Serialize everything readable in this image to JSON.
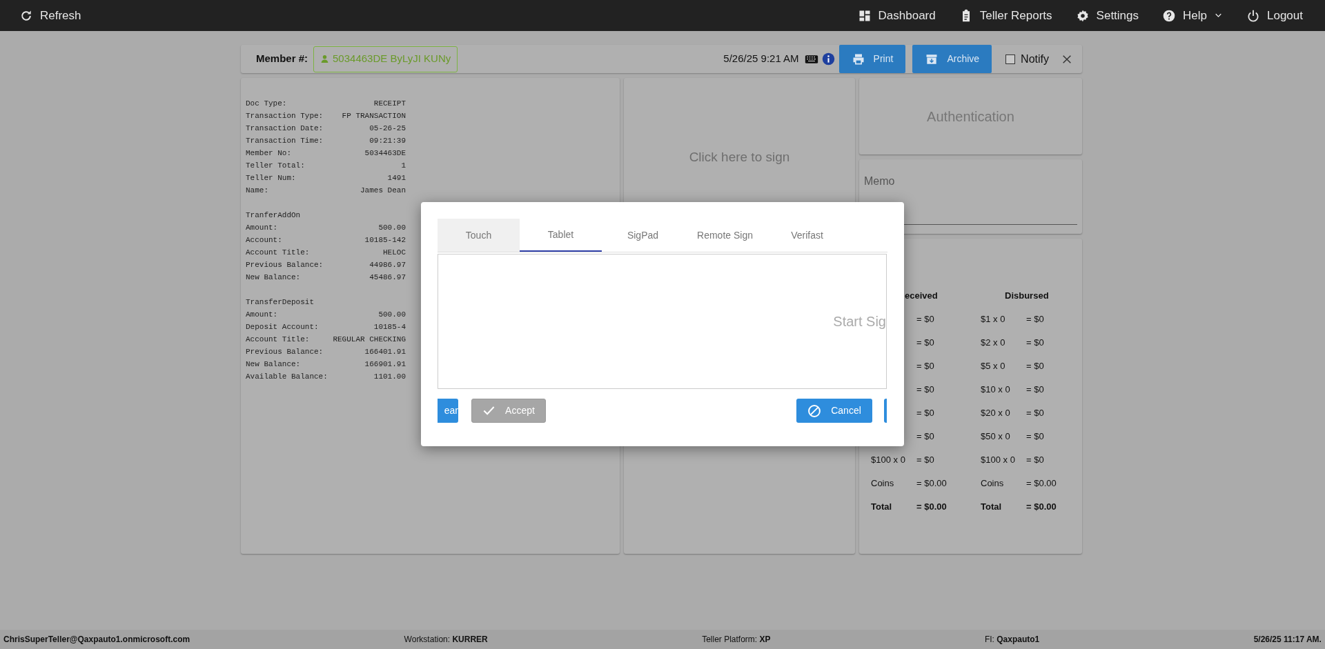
{
  "topbar": {
    "left": [
      {
        "kind": "refresh",
        "label": "Refresh"
      }
    ],
    "right": [
      {
        "kind": "dashboard",
        "label": "Dashboard",
        "dropdown": false
      },
      {
        "kind": "clipboard",
        "label": "Teller Reports",
        "dropdown": false
      },
      {
        "kind": "gear",
        "label": "Settings",
        "dropdown": false
      },
      {
        "kind": "help",
        "label": "Help",
        "dropdown": true
      },
      {
        "kind": "power",
        "label": "Logout",
        "dropdown": false
      }
    ]
  },
  "member_bar": {
    "label": "Member #:",
    "member": "5034463DE ByLyJI KUNy",
    "datetime": "5/26/25 9:21 AM",
    "buttons": [
      {
        "kind": "print",
        "label": "Print"
      },
      {
        "kind": "archive",
        "label": "Archive"
      }
    ],
    "notify": {
      "label": "Notify",
      "checked": false
    }
  },
  "receipt": {
    "groups": [
      {
        "lines": [
          [
            "Doc Type:",
            "RECEIPT"
          ],
          [
            "Transaction Type:",
            "FP TRANSACTION"
          ],
          [
            "Transaction Date:",
            "05-26-25"
          ],
          [
            "Transaction Time:",
            "09:21:39"
          ],
          [
            "Member No:",
            "5034463DE"
          ],
          [
            "Teller Total:",
            "1"
          ],
          [
            "Teller Num:",
            "1491"
          ],
          [
            "Name:",
            "James Dean"
          ]
        ]
      },
      {
        "title": "TranferAddOn",
        "lines": [
          [
            "Amount:",
            "500.00"
          ],
          [
            "Account:",
            "10185-142"
          ],
          [
            "Account Title:",
            "HELOC"
          ],
          [
            "Previous Balance:",
            "44986.97"
          ],
          [
            "New Balance:",
            "45486.97"
          ]
        ]
      },
      {
        "title": "TransferDeposit",
        "lines": [
          [
            "Amount:",
            "500.00"
          ],
          [
            "Deposit Account:",
            "10185-4"
          ],
          [
            "Account Title:",
            "REGULAR CHECKING"
          ],
          [
            "Previous Balance:",
            "166401.91"
          ],
          [
            "New Balance:",
            "166901.91"
          ],
          [
            "Available Balance:",
            "1101.00"
          ]
        ]
      }
    ]
  },
  "signature_panel": {
    "prompt": "Click here to sign"
  },
  "authentication": {
    "title": "Authentication"
  },
  "memo": {
    "label": "Memo"
  },
  "cash": {
    "received": {
      "header": "eceived",
      "rows": [
        {
          "kind": "line",
          "value": "= $0"
        },
        {
          "kind": "line",
          "value": "= $0"
        },
        {
          "kind": "line",
          "value": "= $0"
        },
        {
          "kind": "line",
          "value": "= $0"
        },
        {
          "kind": "line",
          "value": "= $0"
        },
        {
          "kind": "line",
          "value": "= $0"
        },
        {
          "kind": "line",
          "label": "$100 x 0",
          "value": "= $0"
        },
        {
          "kind": "line",
          "label": "Coins",
          "value": "= $0.00"
        },
        {
          "kind": "total",
          "label": "Total",
          "value": "= $0.00"
        }
      ]
    },
    "disbursed": {
      "header": "Disbursed",
      "rows": [
        {
          "kind": "line",
          "label": "$1 x 0",
          "value": "= $0"
        },
        {
          "kind": "line",
          "label": "$2 x 0",
          "value": "= $0"
        },
        {
          "kind": "line",
          "label": "$5 x 0",
          "value": "= $0"
        },
        {
          "kind": "line",
          "label": "$10 x 0",
          "value": "= $0"
        },
        {
          "kind": "line",
          "label": "$20 x 0",
          "value": "= $0"
        },
        {
          "kind": "line",
          "label": "$50 x 0",
          "value": "= $0"
        },
        {
          "kind": "line",
          "label": "$100 x 0",
          "value": "= $0"
        },
        {
          "kind": "line",
          "label": "Coins",
          "value": "= $0.00"
        },
        {
          "kind": "total",
          "label": "Total",
          "value": "= $0.00"
        }
      ]
    }
  },
  "dialog": {
    "tabs": [
      {
        "label": "Touch",
        "selected": false,
        "highlighted": true
      },
      {
        "label": "Tablet",
        "selected": true,
        "highlighted": false
      },
      {
        "label": "SigPad",
        "selected": false,
        "highlighted": false
      },
      {
        "label": "Remote Sign",
        "selected": false,
        "highlighted": false
      },
      {
        "label": "Verifast",
        "selected": false,
        "highlighted": false
      }
    ],
    "pad": {
      "prompt": "Start Sig"
    },
    "buttons": [
      {
        "kind": "clear",
        "label": "ear",
        "disabled": false
      },
      {
        "kind": "accept",
        "label": "Accept",
        "disabled": true
      },
      {
        "kind": "cancel",
        "label": "Cancel",
        "disabled": false
      },
      {
        "kind": "partial",
        "disabled": false
      }
    ]
  },
  "status_bar": [
    {
      "text": "ChrisSuperTeller@Qaxpauto1.onmicrosoft.com",
      "bold": true
    },
    {
      "text": "Workstation: **KURRER**",
      "bold": false
    },
    {
      "text": "Teller Platform: **XP**",
      "bold": false
    },
    {
      "text": "FI: **Qaxpauto1**",
      "bold": false
    },
    {
      "text": "5/26/25 11:17 AM.",
      "bold": true
    }
  ]
}
